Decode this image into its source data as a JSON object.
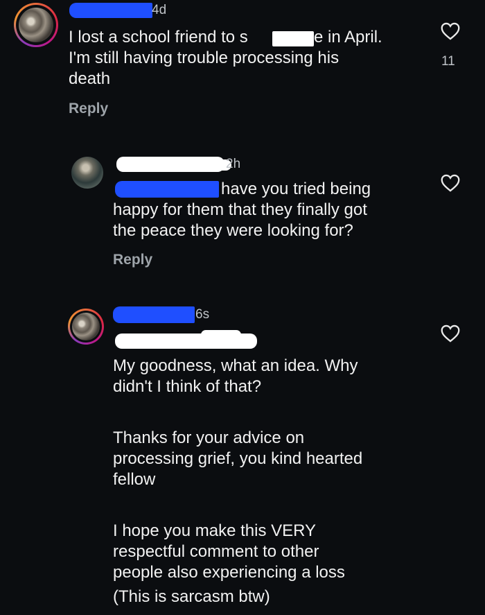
{
  "comments": [
    {
      "time": "4d",
      "text_lines": [
        "I lost a school friend to s",
        "e in April.",
        "I'm still having trouble processing his",
        "death"
      ],
      "reply_label": "Reply",
      "like_count": "11"
    },
    {
      "time": "2h",
      "text_lines": [
        "have you tried being",
        "happy for them that they finally got",
        "the peace they were looking for?"
      ],
      "reply_label": "Reply"
    },
    {
      "time": "6s",
      "paragraphs": [
        "My goodness, what an idea. Why\ndidn't I think of that?",
        "Thanks for your advice on\nprocessing grief, you kind hearted\nfellow",
        "I hope you make this VERY\nrespectful comment to other\npeople also experiencing a loss",
        "(This is sarcasm btw)"
      ]
    }
  ],
  "colors": {
    "background": "#0b0d10",
    "text": "#f2f2f2",
    "muted": "#9ea4aa",
    "redaction_blue": "#1f4fff"
  },
  "icons": {
    "like": "heart-outline-icon"
  }
}
